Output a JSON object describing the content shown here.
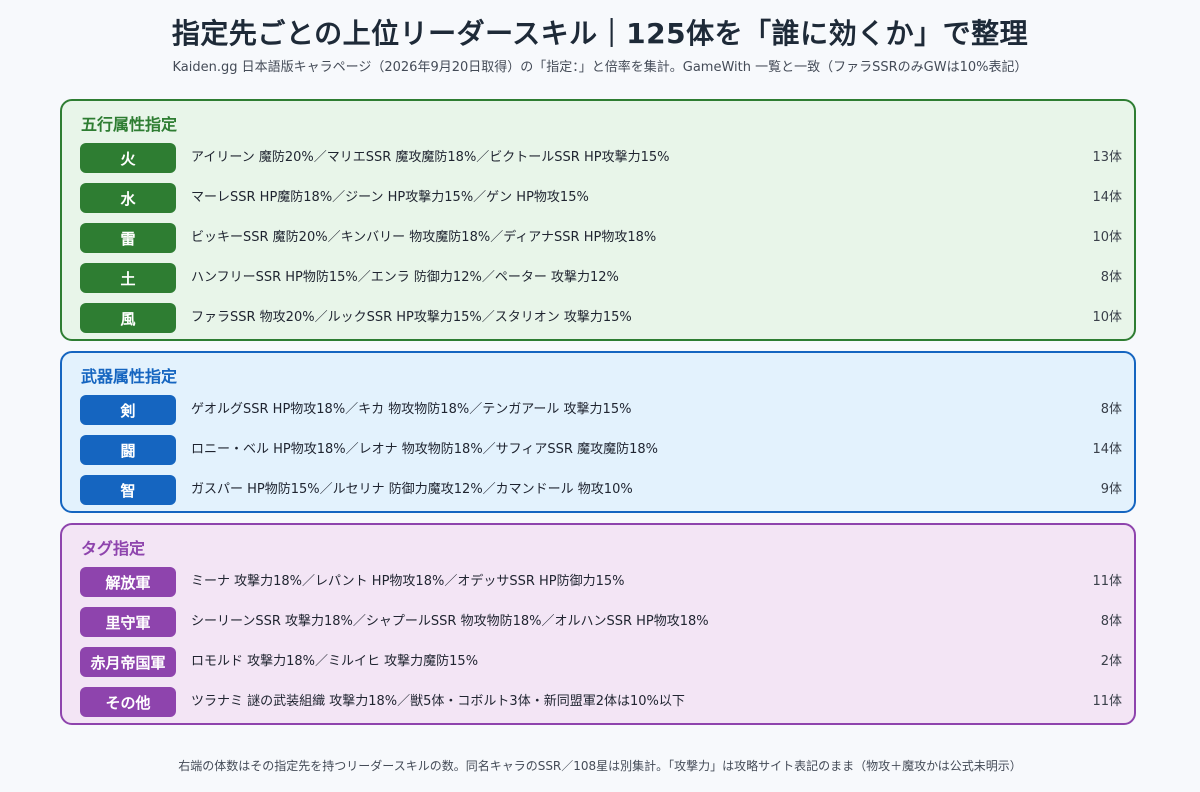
{
  "title": "指定先ごとの上位リーダースキル｜125体を「誰に効くか」で整理",
  "subtitle": "Kaiden.gg 日本語版キャラページ（2026年9月20日取得）の「指定：」と倍率を集計。GameWith 一覧と一致（ファラSSRのみGWは10%表記）",
  "colors": {
    "green_border": "#2e7d32",
    "green_bg": "#e8f5e9",
    "green_tag": "#2e7d32",
    "blue_border": "#1565c0",
    "blue_bg": "#e3f2fd",
    "blue_tag": "#1565c0",
    "purple_border": "#8e44ad",
    "purple_bg": "#f3e5f5",
    "purple_tag": "#8e44ad"
  },
  "sections": [
    {
      "title": "五行属性指定",
      "rows": [
        {
          "tag": "火",
          "desc": "アイリーン 魔防20%／マリエSSR 魔攻魔防18%／ビクトールSSR HP攻撃力15%",
          "count": "13体"
        },
        {
          "tag": "水",
          "desc": "マーレSSR HP魔防18%／ジーン HP攻撃力15%／ゲン HP物攻15%",
          "count": "14体"
        },
        {
          "tag": "雷",
          "desc": "ビッキーSSR 魔防20%／キンバリー 物攻魔防18%／ディアナSSR HP物攻18%",
          "count": "10体"
        },
        {
          "tag": "土",
          "desc": "ハンフリーSSR HP物防15%／エンラ 防御力12%／ペーター 攻撃力12%",
          "count": "8体"
        },
        {
          "tag": "風",
          "desc": "ファラSSR 物攻20%／ルックSSR HP攻撃力15%／スタリオン 攻撃力15%",
          "count": "10体"
        }
      ]
    },
    {
      "title": "武器属性指定",
      "rows": [
        {
          "tag": "剣",
          "desc": "ゲオルグSSR HP物攻18%／キカ 物攻物防18%／テンガアール 攻撃力15%",
          "count": "8体"
        },
        {
          "tag": "闘",
          "desc": "ロニー・ベル HP物攻18%／レオナ 物攻物防18%／サフィアSSR 魔攻魔防18%",
          "count": "14体"
        },
        {
          "tag": "智",
          "desc": "ガスパー HP物防15%／ルセリナ 防御力魔攻12%／カマンドール 物攻10%",
          "count": "9体"
        }
      ]
    },
    {
      "title": "タグ指定",
      "rows": [
        {
          "tag": "解放軍",
          "desc": "ミーナ 攻撃力18%／レパント HP物攻18%／オデッサSSR HP防御力15%",
          "count": "11体"
        },
        {
          "tag": "里守軍",
          "desc": "シーリーンSSR 攻撃力18%／シャプールSSR 物攻物防18%／オルハンSSR HP物攻18%",
          "count": "8体"
        },
        {
          "tag": "赤月帝国軍",
          "desc": "ロモルド 攻撃力18%／ミルイヒ 攻撃力魔防15%",
          "count": "2体"
        },
        {
          "tag": "その他",
          "desc": "ツラナミ 謎の武装組織 攻撃力18%／獣5体・コボルト3体・新同盟軍2体は10%以下",
          "count": "11体"
        }
      ]
    }
  ],
  "footer": "右端の体数はその指定先を持つリーダースキルの数。同名キャラのSSR／108星は別集計。「攻撃力」は攻略サイト表記のまま（物攻＋魔攻かは公式未明示）"
}
